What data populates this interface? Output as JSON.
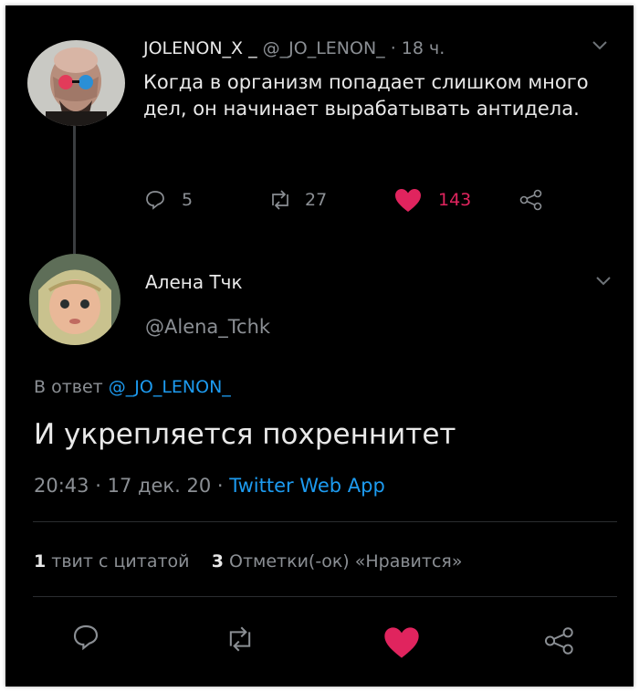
{
  "original_tweet": {
    "display_name": "JOLENON_X _",
    "handle": "@_JO_LENON_",
    "time": "· 18 ч.",
    "text": "Когда в организм попадает слишком много дел, он начинает вырабатывать антидела.",
    "replies": "5",
    "retweets": "27",
    "likes": "143",
    "liked": true
  },
  "reply_tweet": {
    "display_name": "Алена Тчк",
    "handle": "@Alena_Tchk",
    "reply_prefix": "В ответ",
    "reply_to": "@_JO_LENON_",
    "text": "И укрепляется похреннитет",
    "time": "20:43",
    "date": "17 дек. 20",
    "separator": "·",
    "client": "Twitter Web App",
    "quote_count": "1",
    "quote_label": "твит с цитатой",
    "like_count": "3",
    "like_label": "Отметки(-ок) «Нравится»",
    "liked": true
  },
  "colors": {
    "background": "#000000",
    "text": "#e9e9e9",
    "muted": "#8b8f94",
    "link": "#1d9bf0",
    "like": "#e0245e"
  }
}
